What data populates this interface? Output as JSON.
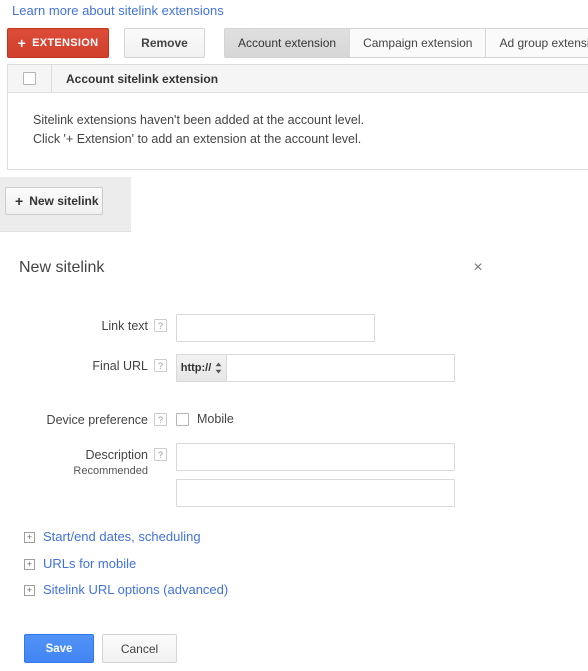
{
  "page": {
    "learn_more_link": "Learn more about sitelink extensions"
  },
  "toolbar": {
    "extension_button": "EXTENSION",
    "extension_plus": "+",
    "remove_button": "Remove",
    "tabs": [
      {
        "label": "Account extension",
        "active": true
      },
      {
        "label": "Campaign extension",
        "active": false
      },
      {
        "label": "Ad group extension",
        "active": false
      }
    ]
  },
  "table": {
    "header_title": "Account sitelink extension",
    "empty_line1": "Sitelink extensions haven't been added at the account level.",
    "empty_line2": "Click '+ Extension' to add an extension at the account level."
  },
  "subpanel": {
    "new_sitelink_button": "New sitelink",
    "new_sitelink_plus": "+"
  },
  "form": {
    "title": "New sitelink",
    "close_label": "×",
    "help_glyph": "?",
    "link_text": {
      "label": "Link text",
      "value": "",
      "placeholder": ""
    },
    "final_url": {
      "label": "Final URL",
      "scheme_value": "http://",
      "value": "",
      "placeholder": ""
    },
    "device_preference": {
      "label": "Device preference",
      "option_label": "Mobile",
      "checked": false
    },
    "description": {
      "label": "Description",
      "sub_label": "Recommended",
      "line1_value": "",
      "line2_value": "",
      "placeholder": ""
    },
    "expanders": [
      {
        "icon": "+",
        "label": "Start/end dates, scheduling"
      },
      {
        "icon": "+",
        "label": "URLs for mobile"
      },
      {
        "icon": "+",
        "label": "Sitelink URL options (advanced)"
      }
    ],
    "save_button": "Save",
    "cancel_button": "Cancel"
  },
  "colors": {
    "brand_red": "#dd4b39",
    "brand_blue": "#4285f4",
    "link_blue": "#4272db",
    "active_tab_gray": "#dddddd",
    "panel_gray": "#ececec"
  }
}
